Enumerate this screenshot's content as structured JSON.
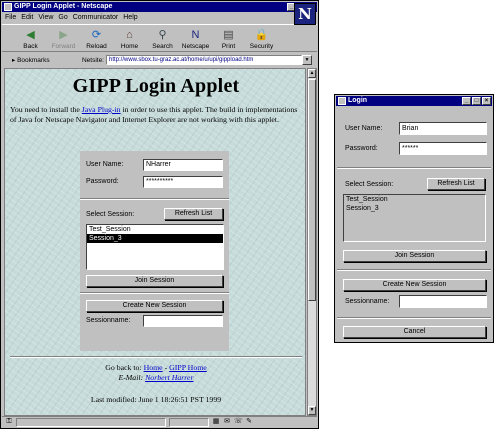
{
  "browser": {
    "title": "GIPP Login Applet - Netscape",
    "menu": [
      "File",
      "Edit",
      "View",
      "Go",
      "Communicator",
      "Help"
    ],
    "toolbar": [
      {
        "label": "Back",
        "icon": "back-arrow-icon",
        "glyph": "◀",
        "color": "#2e7d32",
        "enabled": true
      },
      {
        "label": "Forward",
        "icon": "forward-arrow-icon",
        "glyph": "▶",
        "color": "#8aa58a",
        "enabled": false
      },
      {
        "label": "Reload",
        "icon": "reload-icon",
        "glyph": "⟳",
        "color": "#1565c0",
        "enabled": true
      },
      {
        "label": "Home",
        "icon": "home-icon",
        "glyph": "⌂",
        "color": "#5d4037",
        "enabled": true
      },
      {
        "label": "Search",
        "icon": "search-icon",
        "glyph": "⚲",
        "color": "#37474f",
        "enabled": true
      },
      {
        "label": "Netscape",
        "icon": "netscape-icon",
        "glyph": "N",
        "color": "#1a237e",
        "enabled": true
      },
      {
        "label": "Print",
        "icon": "print-icon",
        "glyph": "▤",
        "color": "#424242",
        "enabled": true
      },
      {
        "label": "Security",
        "icon": "security-lock-icon",
        "glyph": "🔒",
        "color": "#6d4c41",
        "enabled": true
      }
    ],
    "bookmarks_label": "Bookmarks",
    "netsite_label": "Netsite:",
    "url": "http://www.sbox.tu-graz.ac.at/home/u/upi/gippload.htm"
  },
  "page": {
    "title": "GIPP Login Applet",
    "intro_before": "You need to install the ",
    "intro_link": "Java Plug-in",
    "intro_after": " in order to use this applet. The build in implementations of Java for Netscape Navigator and Internet Explorer are not working with this applet.",
    "applet": {
      "user_label": "User Name:",
      "user_value": "NHarrer",
      "password_label": "Password:",
      "password_value": "**********",
      "select_label": "Select Session:",
      "refresh_label": "Refresh List",
      "sessions": [
        "Test_Session",
        "Session_3"
      ],
      "selected_index": 1,
      "join_label": "Join Session",
      "create_label": "Create New Session",
      "sessionname_label": "Sessionname:",
      "sessionname_value": ""
    },
    "goback_label": "Go back to: ",
    "home_link": "Home",
    "dash": " - ",
    "gipp_home_link": "GIPP Home",
    "email_label": "E-Mail: ",
    "email_link": "Norbert Harrer",
    "last_modified": "Last modified: June 1 18:26:51 PST 1999"
  },
  "login_window": {
    "title": "Login",
    "user_label": "User Name:",
    "user_value": "Brian",
    "password_label": "Password:",
    "password_value": "******",
    "select_label": "Select Session:",
    "refresh_label": "Refresh List",
    "sessions": [
      "Test_Session",
      "Session_3"
    ],
    "join_label": "Join Session",
    "create_label": "Create New Session",
    "sessionname_label": "Sessionname:",
    "sessionname_value": "",
    "cancel_label": "Cancel"
  }
}
